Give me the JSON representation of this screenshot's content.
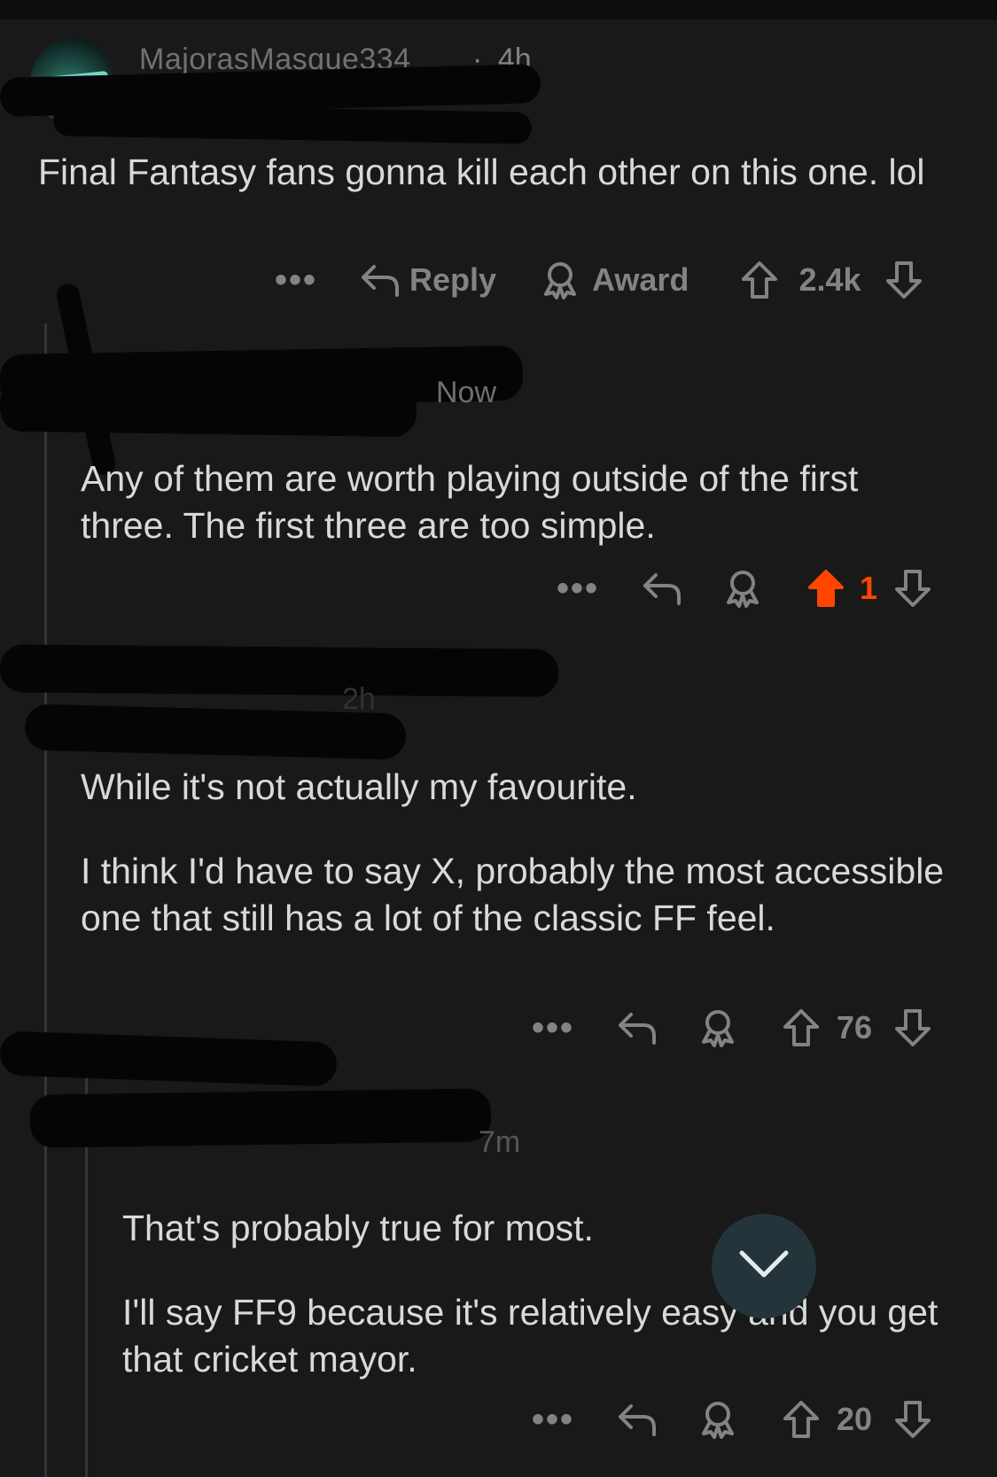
{
  "colors": {
    "background": "#191919",
    "text": "#d7dadc",
    "muted": "#818384",
    "upvote_active": "#ff4500",
    "fab": "#23353a"
  },
  "comments": [
    {
      "username": "MajorasMasque334",
      "time": "4h",
      "separator": "·",
      "body": [
        "Final Fantasy fans gonna kill each other on this one. lol"
      ],
      "actions": {
        "more": "•••",
        "reply": "Reply",
        "award": "Award"
      },
      "score": "2.4k",
      "upvoted": false
    },
    {
      "time": "Now",
      "body": [
        "Any of them are worth playing outside of the first three. The first three are too simple."
      ],
      "actions": {
        "more": "•••"
      },
      "score": "1",
      "upvoted": true
    },
    {
      "time": "2h",
      "body": [
        "While it's not actually my favourite.",
        "I think I'd have to say X, probably the most accessible one that still has a lot of the classic FF feel."
      ],
      "actions": {
        "more": "•••"
      },
      "score": "76",
      "upvoted": false
    },
    {
      "time": "7m",
      "body": [
        "That's probably true for most.",
        "I'll say FF9 because it's relatively easy and you get that cricket mayor."
      ],
      "actions": {
        "more": "•••"
      },
      "score": "20",
      "upvoted": false
    }
  ],
  "icons": {
    "reply": "reply-arrow-icon",
    "award": "award-icon",
    "upvote": "upvote-arrow-icon",
    "downvote": "downvote-arrow-icon",
    "scroll_down": "chevron-down-icon"
  }
}
